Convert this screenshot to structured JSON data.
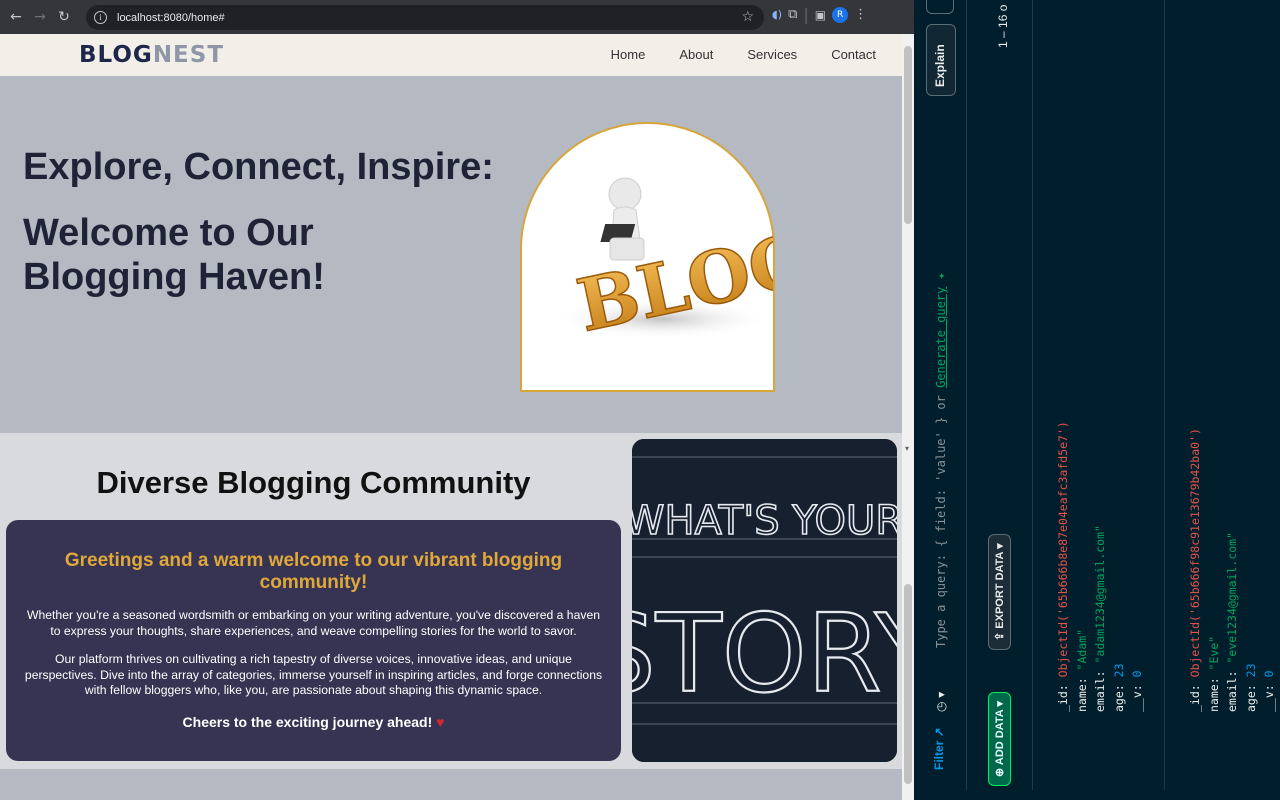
{
  "browser": {
    "url": "localhost:8080/home#",
    "profile_initial": "R"
  },
  "site": {
    "logo_part1": "BLOG",
    "logo_part2": "NEST",
    "nav": [
      "Home",
      "About",
      "Services",
      "Contact"
    ],
    "hero_line1": "Explore, Connect, Inspire:",
    "hero_line2": "Welcome to Our Blogging Haven!",
    "hero_image_text": "BLOG",
    "community_title": "Diverse Blogging Community",
    "card_title": "Greetings and a warm welcome to our vibrant blogging community!",
    "card_p1": "Whether you're a seasoned wordsmith or embarking on your writing adventure, you've discovered a haven to express your thoughts, share experiences, and weave compelling stories for the world to savor.",
    "card_p2": "Our platform thrives on cultivating a rich tapestry of diverse voices, innovative ideas, and unique perspectives. Dive into the array of categories, immerse yourself in inspiring articles, and forge connections with fellow bloggers who, like you, are passionate about shaping this dynamic space.",
    "card_cheers": "Cheers to the exciting journey ahead!",
    "card_heart": "♥",
    "chalk_line1": "WHAT'S YOUR",
    "chalk_line2": "STORY"
  },
  "compass": {
    "explain_label": "Explain",
    "pagination": "1 – 16 o",
    "filter_label": "Filter",
    "query_placeholder": "Type a query: { field: 'value' } or",
    "generate_query": "Generate query",
    "add_data": "ADD DATA",
    "export_data": "EXPORT DATA",
    "documents": [
      {
        "id": "ObjectId('65b666b8e87e04eafc3afd5e7')",
        "name": "\"Adam\"",
        "email": "\"adam1234@gmail.com\"",
        "age": "23",
        "v": "0"
      },
      {
        "id": "ObjectId('65b666f98c91e13679b42ba0')",
        "name": "\"Eve\"",
        "email": "\"eve1234@gmail.com\"",
        "age": "23",
        "v": "0"
      }
    ],
    "key_id": "_id:",
    "key_name": "name:",
    "key_email": "email:",
    "key_age": "age:",
    "key_v": "__v:"
  }
}
